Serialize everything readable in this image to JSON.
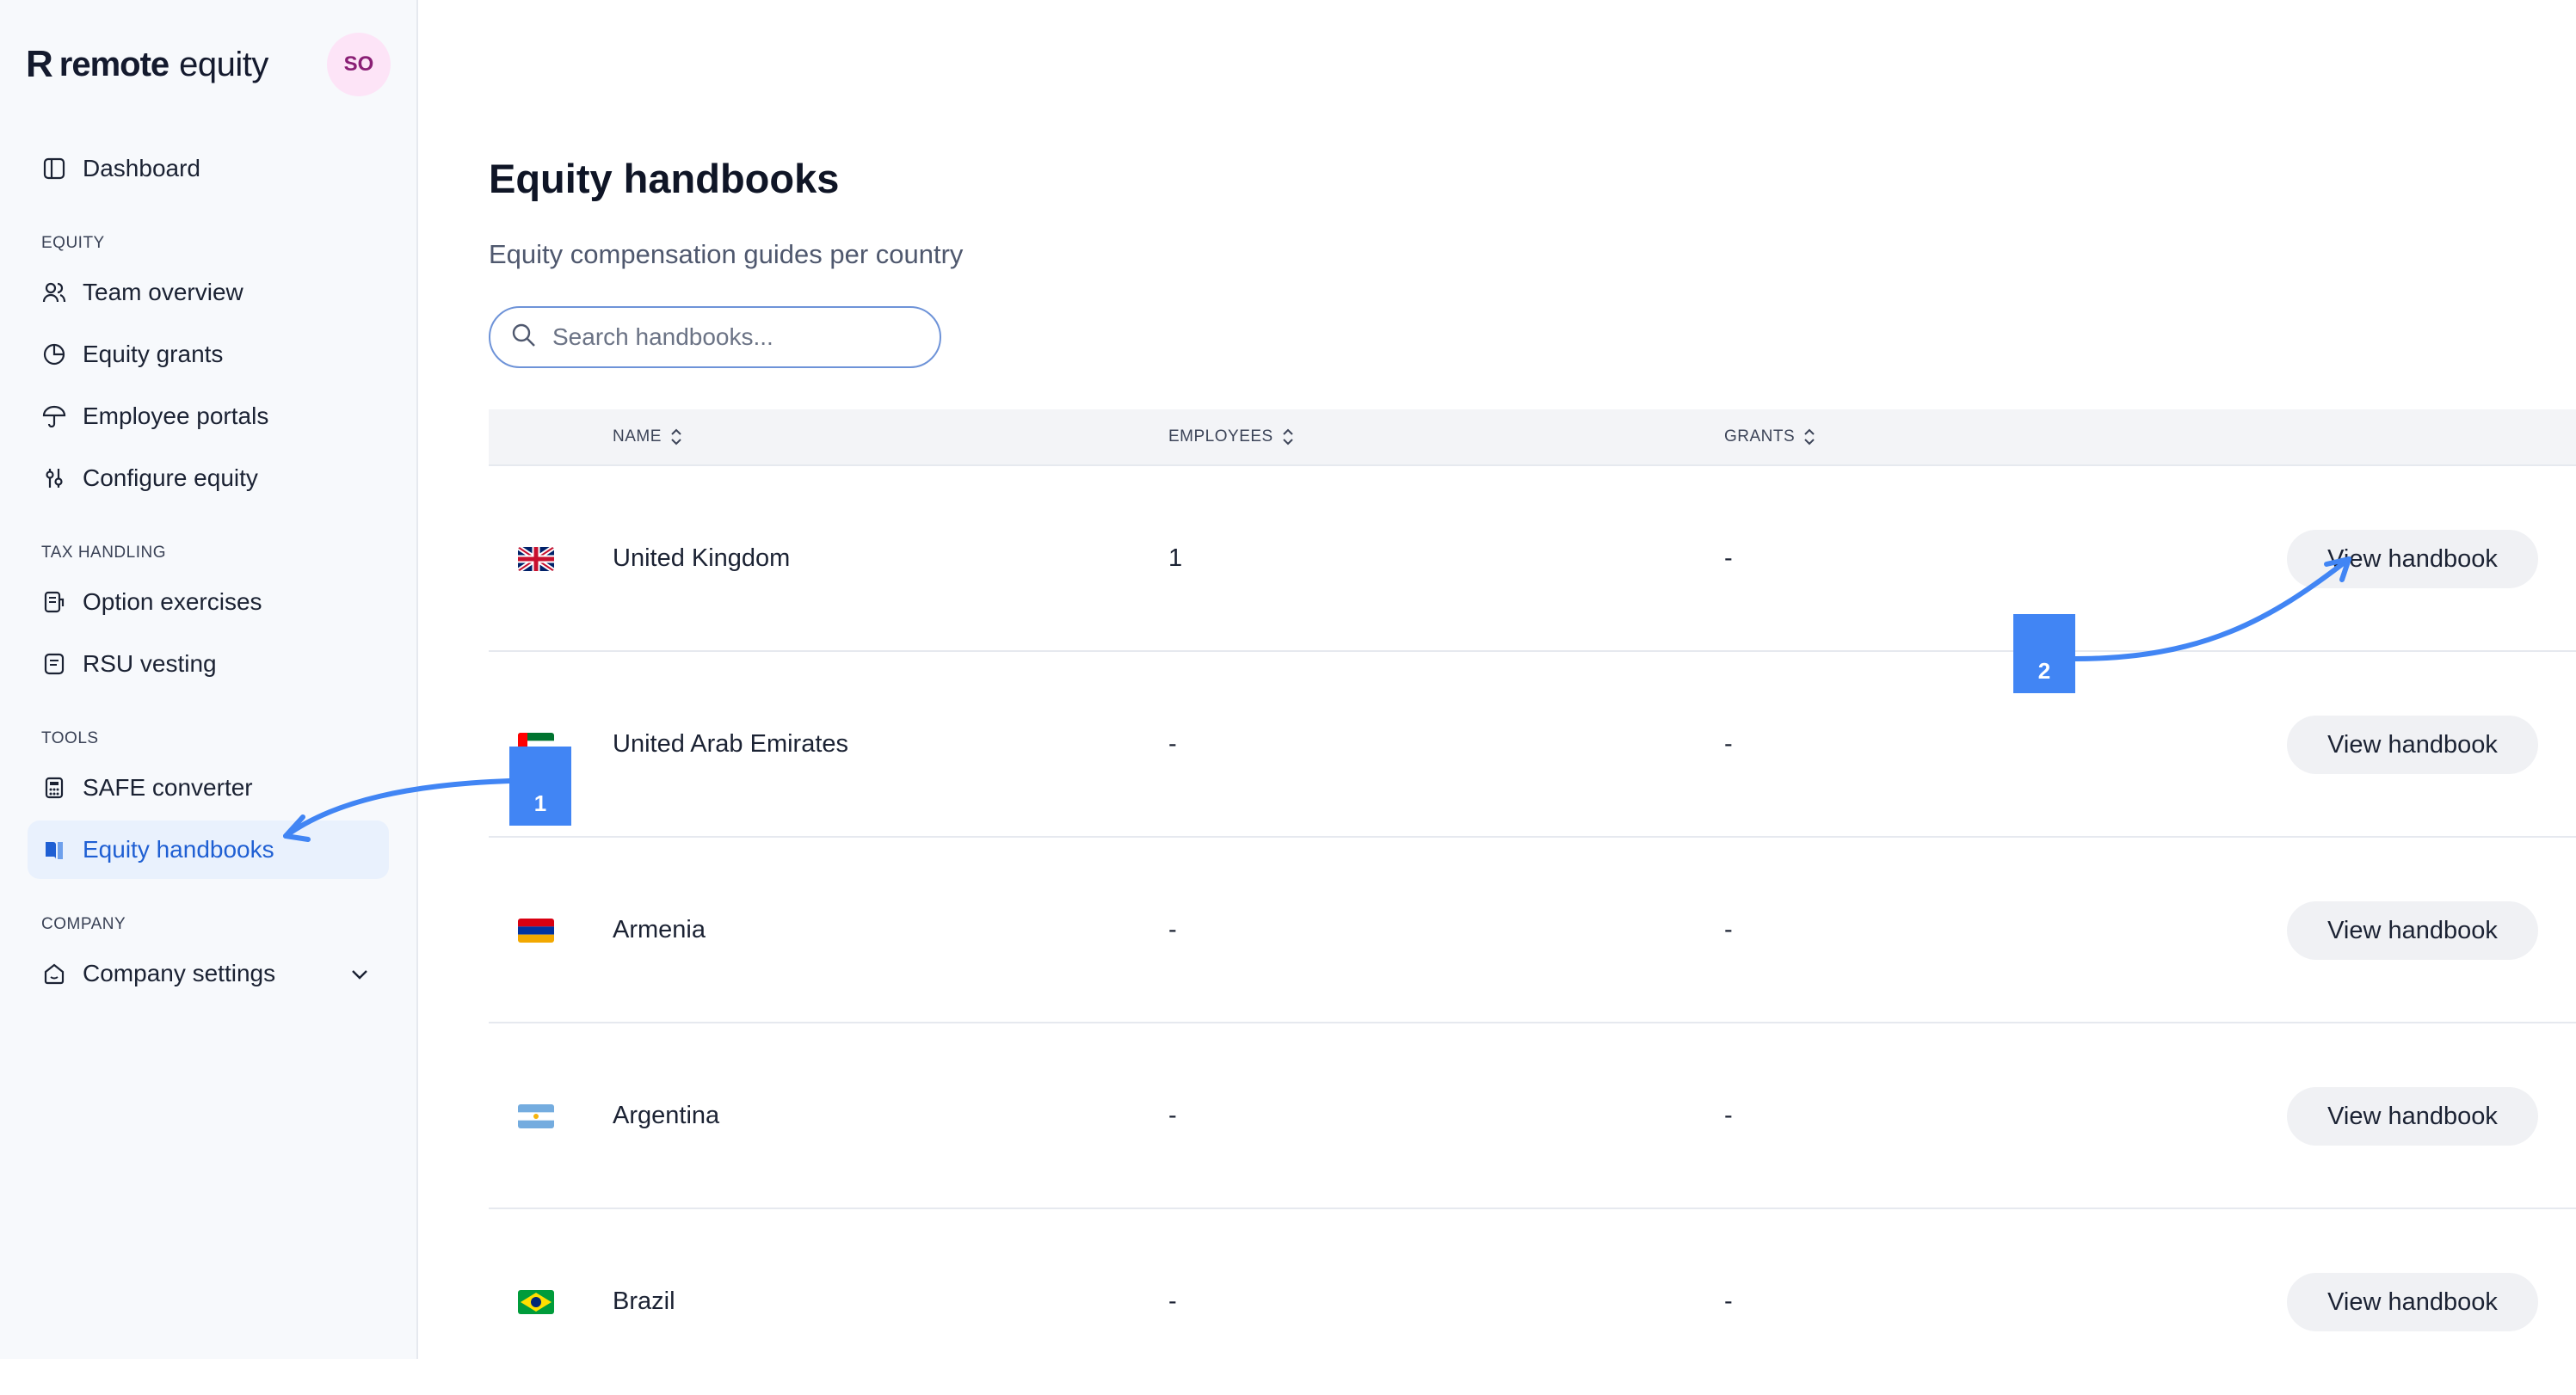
{
  "brand": {
    "mark": "R",
    "name_bold": "remote",
    "name_light": "equity"
  },
  "user": {
    "initials": "SO"
  },
  "sidebar": {
    "dashboard": "Dashboard",
    "sections": {
      "equity": "EQUITY",
      "tax": "TAX HANDLING",
      "tools": "TOOLS",
      "company": "COMPANY"
    },
    "items": {
      "team_overview": "Team overview",
      "equity_grants": "Equity grants",
      "employee_portals": "Employee portals",
      "configure_equity": "Configure equity",
      "option_exercises": "Option exercises",
      "rsu_vesting": "RSU vesting",
      "safe_converter": "SAFE converter",
      "equity_handbooks": "Equity handbooks",
      "company_settings": "Company settings"
    }
  },
  "page": {
    "title": "Equity handbooks",
    "subtitle": "Equity compensation guides per country",
    "search_placeholder": "Search handbooks..."
  },
  "table": {
    "columns": {
      "name": "NAME",
      "employees": "EMPLOYEES",
      "grants": "GRANTS"
    },
    "rows": [
      {
        "flag": "uk",
        "name": "United Kingdom",
        "employees": "1",
        "grants": "-",
        "action": "View handbook"
      },
      {
        "flag": "uae",
        "name": "United Arab Emirates",
        "employees": "-",
        "grants": "-",
        "action": "View handbook"
      },
      {
        "flag": "armenia",
        "name": "Armenia",
        "employees": "-",
        "grants": "-",
        "action": "View handbook"
      },
      {
        "flag": "argentina",
        "name": "Argentina",
        "employees": "-",
        "grants": "-",
        "action": "View handbook"
      },
      {
        "flag": "brazil",
        "name": "Brazil",
        "employees": "-",
        "grants": "-",
        "action": "View handbook"
      }
    ]
  },
  "annotations": {
    "step1": "1",
    "step2": "2",
    "color": "#4185f4"
  }
}
